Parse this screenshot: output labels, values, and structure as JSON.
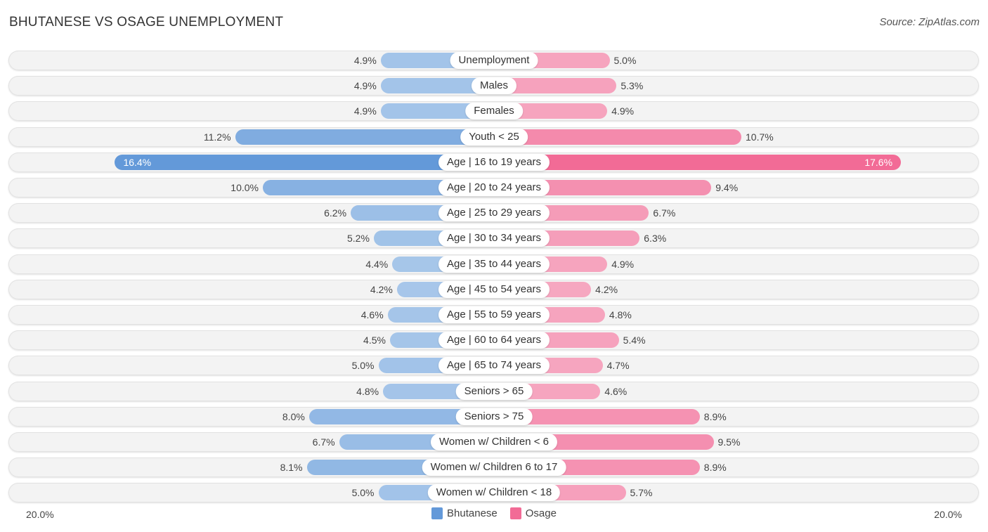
{
  "title": "BHUTANESE VS OSAGE UNEMPLOYMENT",
  "source": "Source: ZipAtlas.com",
  "colors": {
    "bhutanese": "#a8c7ea",
    "bhutanese_strong": "#6399d9",
    "osage": "#f6a8c1",
    "osage_strong": "#f26b96"
  },
  "legend": [
    {
      "label": "Bhutanese",
      "color": "#6399d9"
    },
    {
      "label": "Osage",
      "color": "#f26b96"
    }
  ],
  "axis": {
    "left_label": "20.0%",
    "right_label": "20.0%"
  },
  "chart_data": {
    "type": "bar",
    "orientation": "horizontal-diverging",
    "title": "BHUTANESE VS OSAGE UNEMPLOYMENT",
    "xlim": [
      -20,
      20
    ],
    "x_tick_labels": [
      "20.0%",
      "20.0%"
    ],
    "legend_position": "bottom-center",
    "categories": [
      "Unemployment",
      "Males",
      "Females",
      "Youth < 25",
      "Age | 16 to 19 years",
      "Age | 20 to 24 years",
      "Age | 25 to 29 years",
      "Age | 30 to 34 years",
      "Age | 35 to 44 years",
      "Age | 45 to 54 years",
      "Age | 55 to 59 years",
      "Age | 60 to 64 years",
      "Age | 65 to 74 years",
      "Seniors > 65",
      "Seniors > 75",
      "Women w/ Children < 6",
      "Women w/ Children 6 to 17",
      "Women w/ Children < 18"
    ],
    "series": [
      {
        "name": "Bhutanese",
        "unit": "%",
        "values": [
          4.9,
          4.9,
          4.9,
          11.2,
          16.4,
          10.0,
          6.2,
          5.2,
          4.4,
          4.2,
          4.6,
          4.5,
          5.0,
          4.8,
          8.0,
          6.7,
          8.1,
          5.0
        ],
        "labels": [
          "4.9%",
          "4.9%",
          "4.9%",
          "11.2%",
          "16.4%",
          "10.0%",
          "6.2%",
          "5.2%",
          "4.4%",
          "4.2%",
          "4.6%",
          "4.5%",
          "5.0%",
          "4.8%",
          "8.0%",
          "6.7%",
          "8.1%",
          "5.0%"
        ]
      },
      {
        "name": "Osage",
        "unit": "%",
        "values": [
          5.0,
          5.3,
          4.9,
          10.7,
          17.6,
          9.4,
          6.7,
          6.3,
          4.9,
          4.2,
          4.8,
          5.4,
          4.7,
          4.6,
          8.9,
          9.5,
          8.9,
          5.7
        ],
        "labels": [
          "5.0%",
          "5.3%",
          "4.9%",
          "10.7%",
          "17.6%",
          "9.4%",
          "6.7%",
          "6.3%",
          "4.9%",
          "4.2%",
          "4.8%",
          "5.4%",
          "4.7%",
          "4.6%",
          "8.9%",
          "9.5%",
          "8.9%",
          "5.7%"
        ]
      }
    ]
  }
}
